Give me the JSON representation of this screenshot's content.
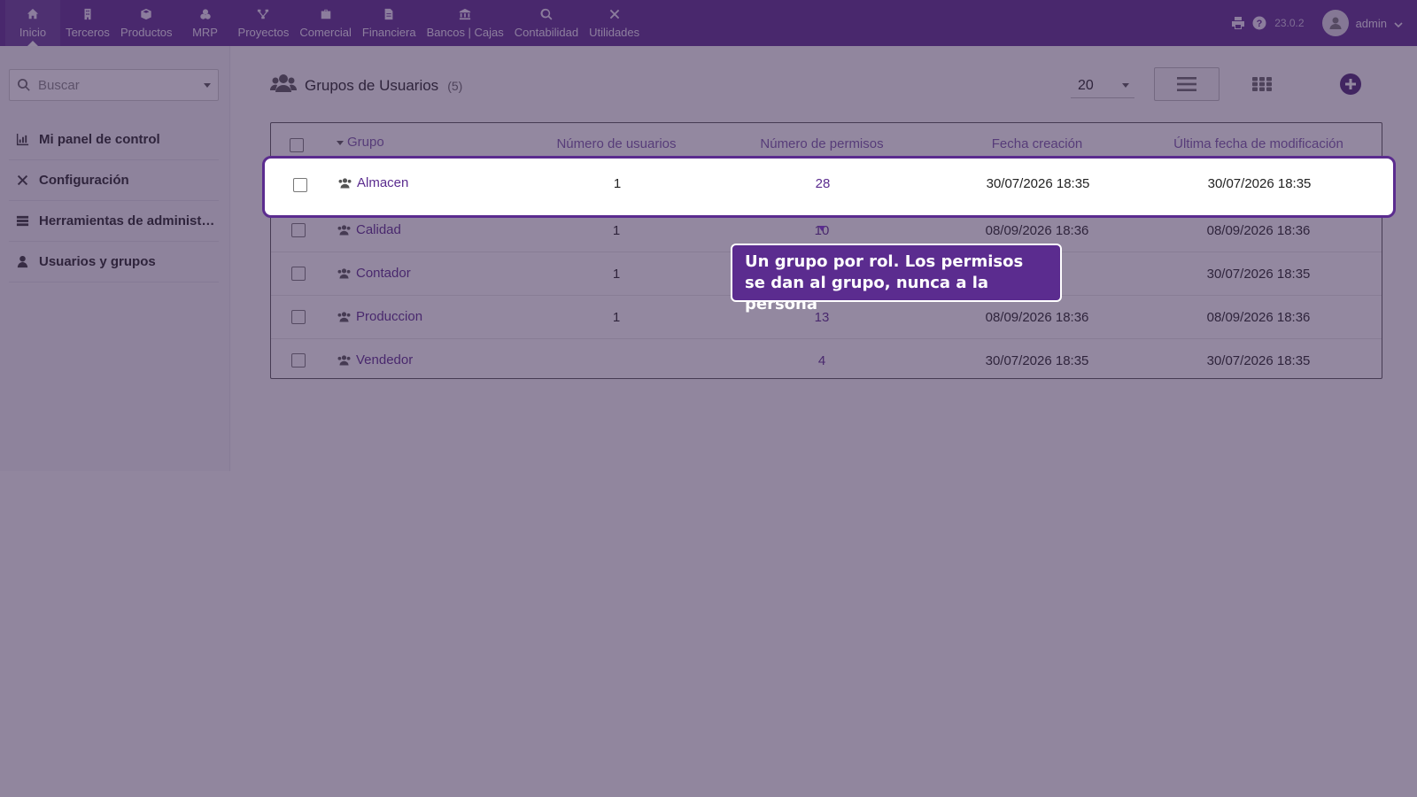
{
  "topbar": {
    "menu": [
      {
        "label": "Inicio",
        "icon": "home-icon",
        "active": true
      },
      {
        "label": "Terceros",
        "icon": "building-icon"
      },
      {
        "label": "Productos",
        "icon": "cube-icon"
      },
      {
        "label": "MRP",
        "icon": "cubes-icon"
      },
      {
        "label": "Proyectos",
        "icon": "sitemap-icon"
      },
      {
        "label": "Comercial",
        "icon": "briefcase-icon"
      },
      {
        "label": "Financiera",
        "icon": "file-icon"
      },
      {
        "label": "Bancos | Cajas",
        "icon": "bank-icon"
      },
      {
        "label": "Contabilidad",
        "icon": "search-dollar-icon"
      },
      {
        "label": "Utilidades",
        "icon": "tools-icon"
      }
    ],
    "version": "23.0.2",
    "user": "admin"
  },
  "sidebar": {
    "search_placeholder": "Buscar",
    "items": [
      {
        "label": "Mi panel de control",
        "icon": "chart-bar-icon"
      },
      {
        "label": "Configuración",
        "icon": "tools-icon"
      },
      {
        "label": "Herramientas de administración",
        "icon": "server-icon"
      },
      {
        "label": "Usuarios y grupos",
        "icon": "user-icon"
      }
    ]
  },
  "main": {
    "title": "Grupos de Usuarios",
    "count": "(5)",
    "page_size": "20",
    "columns": {
      "group": "Grupo",
      "users": "Número de usuarios",
      "perms": "Número de permisos",
      "created": "Fecha creación",
      "modified": "Última fecha de modificación"
    },
    "rows": [
      {
        "name": "Almacen",
        "users": "1",
        "perms": "28",
        "created": "30/07/2026 18:35",
        "modified": "30/07/2026 18:35"
      },
      {
        "name": "Calidad",
        "users": "1",
        "perms": "10",
        "created": "08/09/2026 18:36",
        "modified": "08/09/2026 18:36"
      },
      {
        "name": "Contador",
        "users": "1",
        "perms": "",
        "created": "",
        "modified": "30/07/2026 18:35"
      },
      {
        "name": "Produccion",
        "users": "1",
        "perms": "13",
        "created": "08/09/2026 18:36",
        "modified": "08/09/2026 18:36"
      },
      {
        "name": "Vendedor",
        "users": "",
        "perms": "4",
        "created": "30/07/2026 18:35",
        "modified": "30/07/2026 18:35"
      }
    ]
  },
  "tooltip": {
    "text": "Un grupo por rol. Los permisos se dan al grupo, nunca a la persona"
  },
  "colors": {
    "brand": "#5b2c8f",
    "overlay": "#3a2652"
  }
}
